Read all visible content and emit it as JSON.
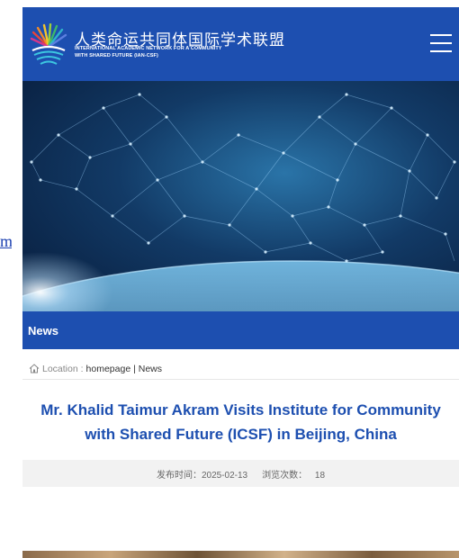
{
  "side_link": {
    "text": "m"
  },
  "header": {
    "title": "人类命运共同体国际学术联盟",
    "subtitle_line1": "INTERNATIONAL ACADEMIC NETWORK FOR A COMMUNITY",
    "subtitle_line2": "WITH SHARED FUTURE (IAN-CSF)",
    "logo_icon": "sunburst-logo-icon",
    "menu_icon": "hamburger-menu-icon"
  },
  "section": {
    "label": "News"
  },
  "location": {
    "icon": "home-icon",
    "label": "Location :",
    "crumb": "homepage | News"
  },
  "article": {
    "title": "Mr. Khalid Taimur Akram Visits Institute for Community with Shared Future (ICSF) in Beijing, China",
    "published_label": "发布时间：2025-02-13",
    "views_label": "浏览次数：",
    "views_count": "18"
  },
  "colors": {
    "brand_blue": "#1d4fb0"
  }
}
